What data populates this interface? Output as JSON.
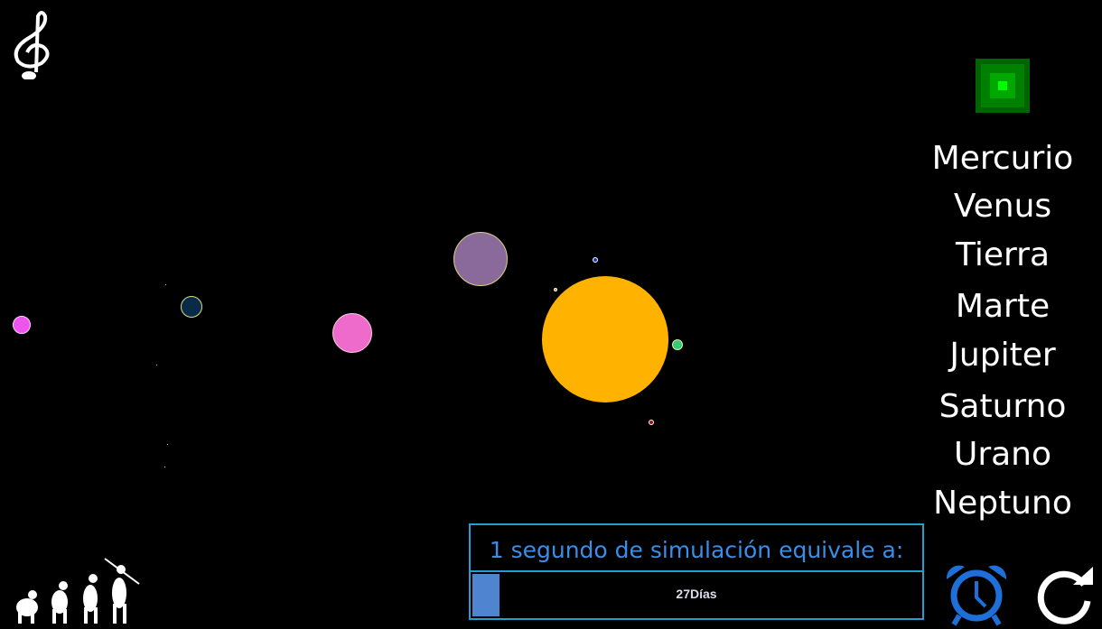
{
  "planets_menu": [
    "Mercurio",
    "Venus",
    "Tierra",
    "Marte",
    "Jupiter",
    "Saturno",
    "Urano",
    "Neptuno"
  ],
  "speed": {
    "title": "1 segundo de simulación equivale a:",
    "value_label": "27Días",
    "progress_percent": 6
  },
  "colors": {
    "sun": "#ffb300",
    "accent": "#1fa0d0",
    "alarm": "#1e6fd9"
  },
  "icons": {
    "music": "treble-clef-icon",
    "evolution": "evolution-icon",
    "alarm": "alarm-clock-icon",
    "reset": "refresh-icon",
    "view": "green-square-icon"
  }
}
